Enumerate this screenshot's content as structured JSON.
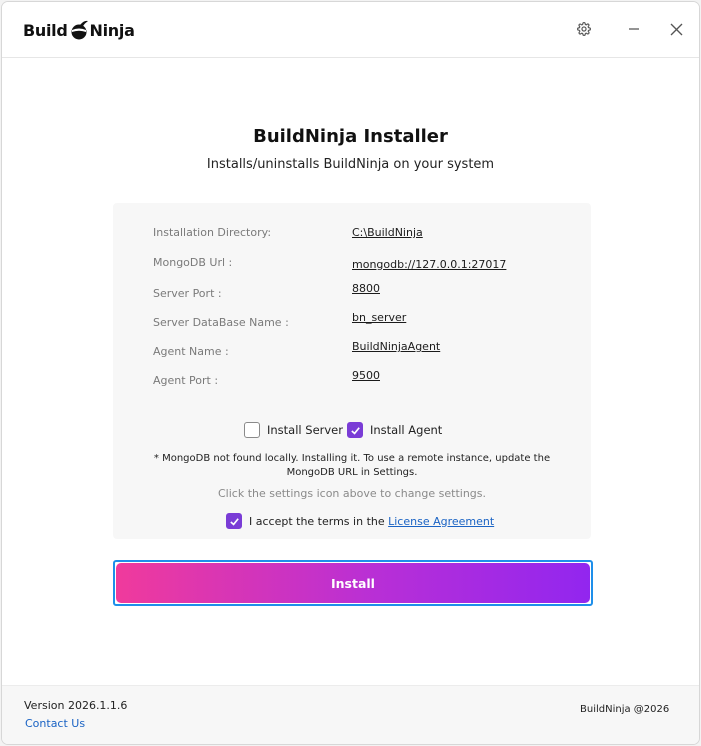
{
  "window": {
    "logo_left": "Build",
    "logo_right": "Ninja"
  },
  "header": {
    "title": "BuildNinja Installer",
    "subtitle": "Installs/uninstalls BuildNinja on your system"
  },
  "settings": [
    {
      "label": "Installation Directory:",
      "value": "C:\\BuildNinja"
    },
    {
      "label": "MongoDB Url :",
      "value": "mongodb://127.0.0.1:27017"
    },
    {
      "label": "Server Port :",
      "value": "8800"
    },
    {
      "label": "Server DataBase Name :",
      "value": "bn_server"
    },
    {
      "label": "Agent Name :",
      "value": "BuildNinjaAgent"
    },
    {
      "label": "Agent Port :",
      "value": "9500"
    }
  ],
  "options": {
    "install_server": {
      "label": "Install Server",
      "checked": false
    },
    "install_agent": {
      "label": "Install Agent",
      "checked": true
    }
  },
  "note": "* MongoDB not found locally. Installing it. To use a remote instance, update the MongoDB URL in Settings.",
  "hint": "Click the settings icon above to change settings.",
  "terms": {
    "prefix": "I accept the terms in the ",
    "link": "License Agreement",
    "checked": true
  },
  "install_button": "Install",
  "footer": {
    "version": "Version 2026.1.1.6",
    "contact": "Contact Us",
    "copyright": "BuildNinja @2026"
  },
  "colors": {
    "accent": "#7a3cd6",
    "gradient_start": "#f03a9c",
    "gradient_end": "#9226ef",
    "link": "#1a63c4",
    "focus_ring": "#1e8fea"
  },
  "icons": {
    "gear": "gear-icon",
    "minimize": "minimize-icon",
    "close": "close-icon",
    "check": "checkmark-icon"
  }
}
